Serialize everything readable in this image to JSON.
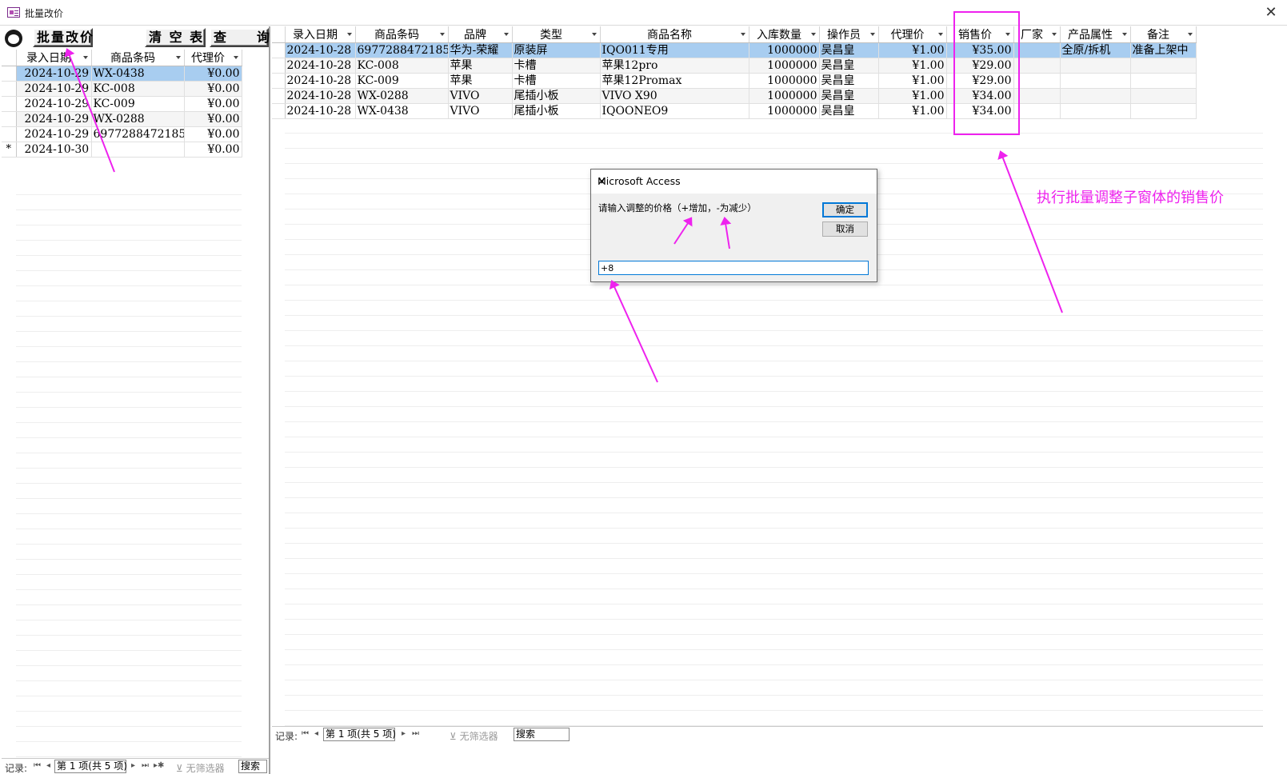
{
  "window": {
    "title": "批量改价",
    "close": "✕"
  },
  "left": {
    "buttons": {
      "batch": "批量改价",
      "clear": "清 空 表",
      "query": "查　　询"
    },
    "columns": [
      "录入日期",
      "商品条码",
      "代理价"
    ],
    "rows": [
      {
        "date": "2024-10-29",
        "code": "WX-0438",
        "price": "¥0.00"
      },
      {
        "date": "2024-10-29",
        "code": "KC-008",
        "price": "¥0.00"
      },
      {
        "date": "2024-10-29",
        "code": "KC-009",
        "price": "¥0.00"
      },
      {
        "date": "2024-10-29",
        "code": "WX-0288",
        "price": "¥0.00"
      },
      {
        "date": "2024-10-29",
        "code": "6977288472185",
        "price": "¥0.00"
      }
    ],
    "new_row": {
      "marker": "*",
      "date": "2024-10-30",
      "price": "¥0.00"
    },
    "nav": {
      "label": "记录:",
      "position": "第 1 项(共 5 项)",
      "filter": "无筛选器",
      "search": "搜索"
    }
  },
  "right": {
    "columns": [
      "录入日期",
      "商品条码",
      "品牌",
      "类型",
      "商品名称",
      "入库数量",
      "操作员",
      "代理价",
      "销售价",
      "厂家",
      "产品属性",
      "备注"
    ],
    "rows": [
      [
        "2024-10-28",
        "6977288472185",
        "华为-荣耀",
        "原装屏",
        "IQO011专用",
        "1000000",
        "吴昌皇",
        "¥1.00",
        "¥35.00",
        "",
        "全原/拆机",
        "准备上架中"
      ],
      [
        "2024-10-28",
        "KC-008",
        "苹果",
        "卡槽",
        "苹果12pro",
        "1000000",
        "吴昌皇",
        "¥1.00",
        "¥29.00",
        "",
        "",
        ""
      ],
      [
        "2024-10-28",
        "KC-009",
        "苹果",
        "卡槽",
        "苹果12Promax",
        "1000000",
        "吴昌皇",
        "¥1.00",
        "¥29.00",
        "",
        "",
        ""
      ],
      [
        "2024-10-28",
        "WX-0288",
        "VIVO",
        "尾插小板",
        "VIVO X90",
        "1000000",
        "吴昌皇",
        "¥1.00",
        "¥34.00",
        "",
        "",
        ""
      ],
      [
        "2024-10-28",
        "WX-0438",
        "VIVO",
        "尾插小板",
        "IQOONEO9",
        "1000000",
        "吴昌皇",
        "¥1.00",
        "¥34.00",
        "",
        "",
        ""
      ]
    ],
    "nav": {
      "label": "记录:",
      "position": "第 1 项(共 5 项)",
      "filter": "无筛选器",
      "search": "搜索"
    }
  },
  "dialog": {
    "title": "Microsoft Access",
    "prompt": "请输入调整的价格（+增加，-为减少）",
    "ok": "确定",
    "cancel": "取消",
    "input_value": "+8"
  },
  "annotation": {
    "text": "执行批量调整子窗体的销售价",
    "color": "#ee22ee"
  }
}
